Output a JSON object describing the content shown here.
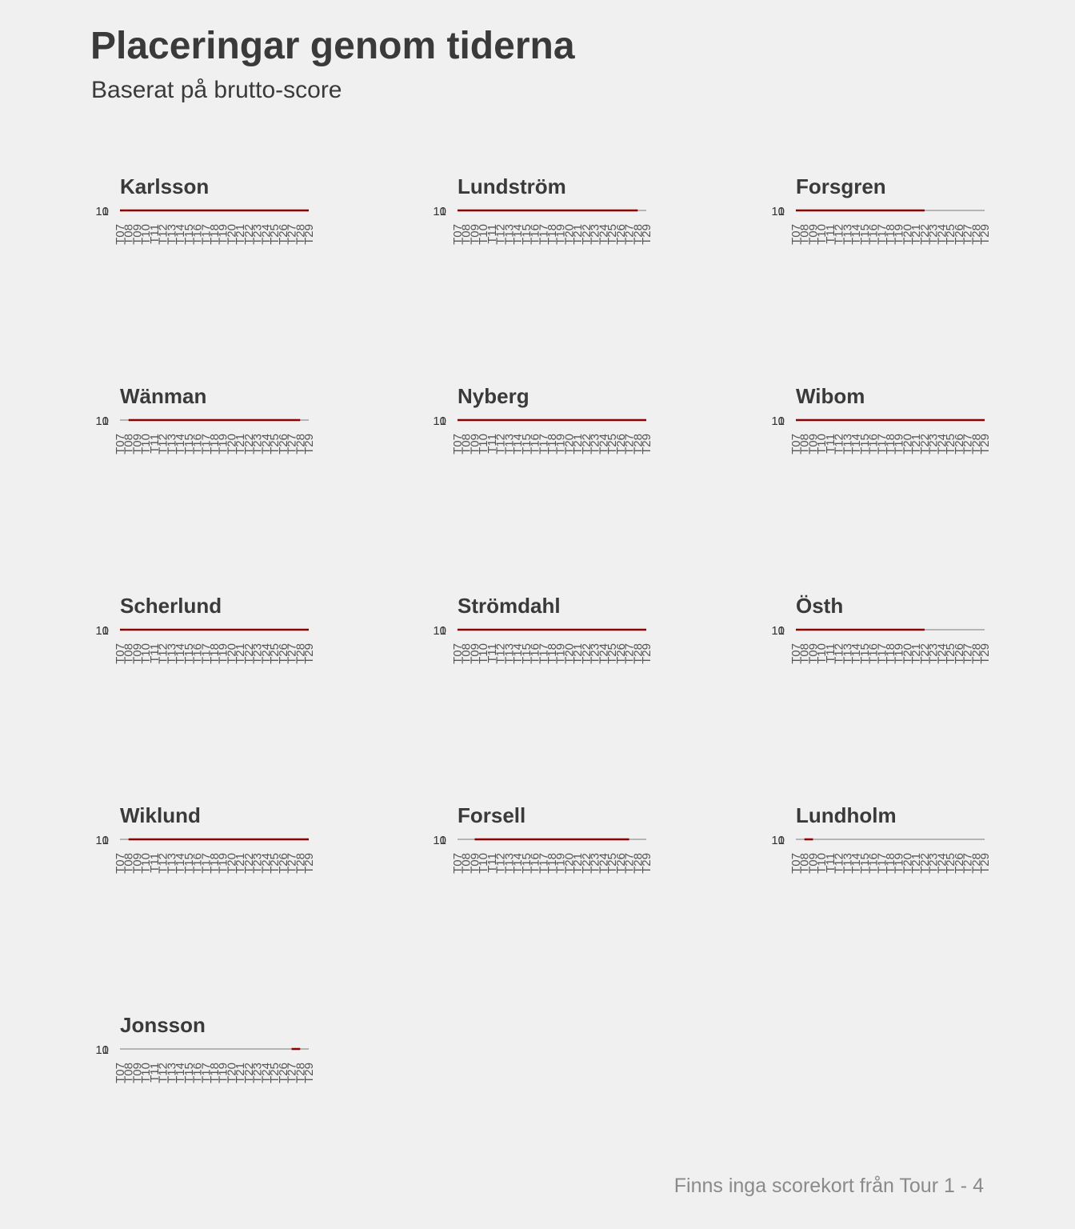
{
  "header": {
    "title": "Placeringar genom tiderna",
    "subtitle": "Baserat på brutto-score"
  },
  "footer": {
    "caption": "Finns inga scorekort från Tour 1 - 4"
  },
  "colors": {
    "background": "#f0f0f0",
    "player_line": "#8b0000",
    "other_lines": "#b5b5b5",
    "text": "#3a3a3a"
  },
  "chart_data": {
    "type": "line",
    "facet_by": "player",
    "layout": "3 columns, 5 rows",
    "grid": false,
    "legend": "none",
    "x_tick_labels": [
      "T07",
      "T08",
      "T09",
      "T10",
      "T11",
      "T12",
      "T13",
      "T14",
      "T15",
      "T16",
      "T17",
      "T18",
      "T19",
      "T20",
      "T21",
      "T22",
      "T23",
      "T24",
      "T25",
      "T26",
      "T27",
      "T28",
      "T29"
    ],
    "y_ticks": [
      "10",
      "1"
    ],
    "highlight_description": "Each panel highlights one player's placement line (dark red) over the grey lines of all other players.",
    "facets": [
      {
        "player": "Karlsson",
        "highlight_x_range": [
          "T07",
          "T29"
        ]
      },
      {
        "player": "Lundström",
        "highlight_x_range": [
          "T07",
          "T28"
        ]
      },
      {
        "player": "Forsgren",
        "highlight_x_range": [
          "T07",
          "T22"
        ]
      },
      {
        "player": "Wänman",
        "highlight_x_range": [
          "T08",
          "T28"
        ]
      },
      {
        "player": "Nyberg",
        "highlight_x_range": [
          "T07",
          "T29"
        ]
      },
      {
        "player": "Wibom",
        "highlight_x_range": [
          "T07",
          "T29"
        ]
      },
      {
        "player": "Scherlund",
        "highlight_x_range": [
          "T07",
          "T29"
        ]
      },
      {
        "player": "Strömdahl",
        "highlight_x_range": [
          "T07",
          "T29"
        ]
      },
      {
        "player": "Östh",
        "highlight_x_range": [
          "T07",
          "T22"
        ]
      },
      {
        "player": "Wiklund",
        "highlight_x_range": [
          "T08",
          "T29"
        ]
      },
      {
        "player": "Forsell",
        "highlight_x_range": [
          "T09",
          "T27"
        ]
      },
      {
        "player": "Lundholm",
        "highlight_x_range": [
          "T08",
          "T09"
        ]
      },
      {
        "player": "Jonsson",
        "highlight_x_range": [
          "T27",
          "T28"
        ]
      }
    ]
  }
}
